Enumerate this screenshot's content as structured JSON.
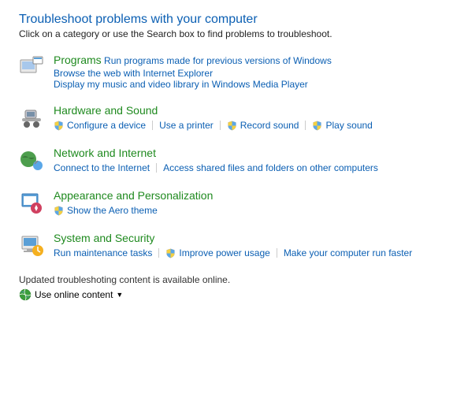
{
  "header": {
    "title": "Troubleshoot problems with your computer",
    "subtitle": "Click on a category or use the Search box to find problems to troubleshoot."
  },
  "categories": [
    {
      "icon": "programs",
      "title": "Programs",
      "links": [
        {
          "label": "Run programs made for previous versions of Windows",
          "shield": false
        },
        {
          "label": "Browse the web with Internet Explorer",
          "shield": false
        },
        {
          "label": "Display my music and video library in Windows Media Player",
          "shield": false
        }
      ],
      "wrap": "stack"
    },
    {
      "icon": "hardware",
      "title": "Hardware and Sound",
      "links": [
        {
          "label": "Configure a device",
          "shield": true
        },
        {
          "label": "Use a printer",
          "shield": false
        },
        {
          "label": "Record sound",
          "shield": true
        },
        {
          "label": "Play sound",
          "shield": true
        }
      ],
      "wrap": "inline"
    },
    {
      "icon": "network",
      "title": "Network and Internet",
      "links": [
        {
          "label": "Connect to the Internet",
          "shield": false
        },
        {
          "label": "Access shared files and folders on other computers",
          "shield": false
        }
      ],
      "wrap": "inline"
    },
    {
      "icon": "appearance",
      "title": "Appearance and Personalization",
      "links": [
        {
          "label": "Show the Aero theme",
          "shield": true
        }
      ],
      "wrap": "inline"
    },
    {
      "icon": "system",
      "title": "System and Security",
      "links": [
        {
          "label": "Run maintenance tasks",
          "shield": false
        },
        {
          "label": "Improve power usage",
          "shield": true
        },
        {
          "label": "Make your computer run faster",
          "shield": false
        }
      ],
      "wrap": "inline"
    }
  ],
  "footer": {
    "status": "Updated troubleshoting content is available online.",
    "dropdown": "Use online content"
  }
}
